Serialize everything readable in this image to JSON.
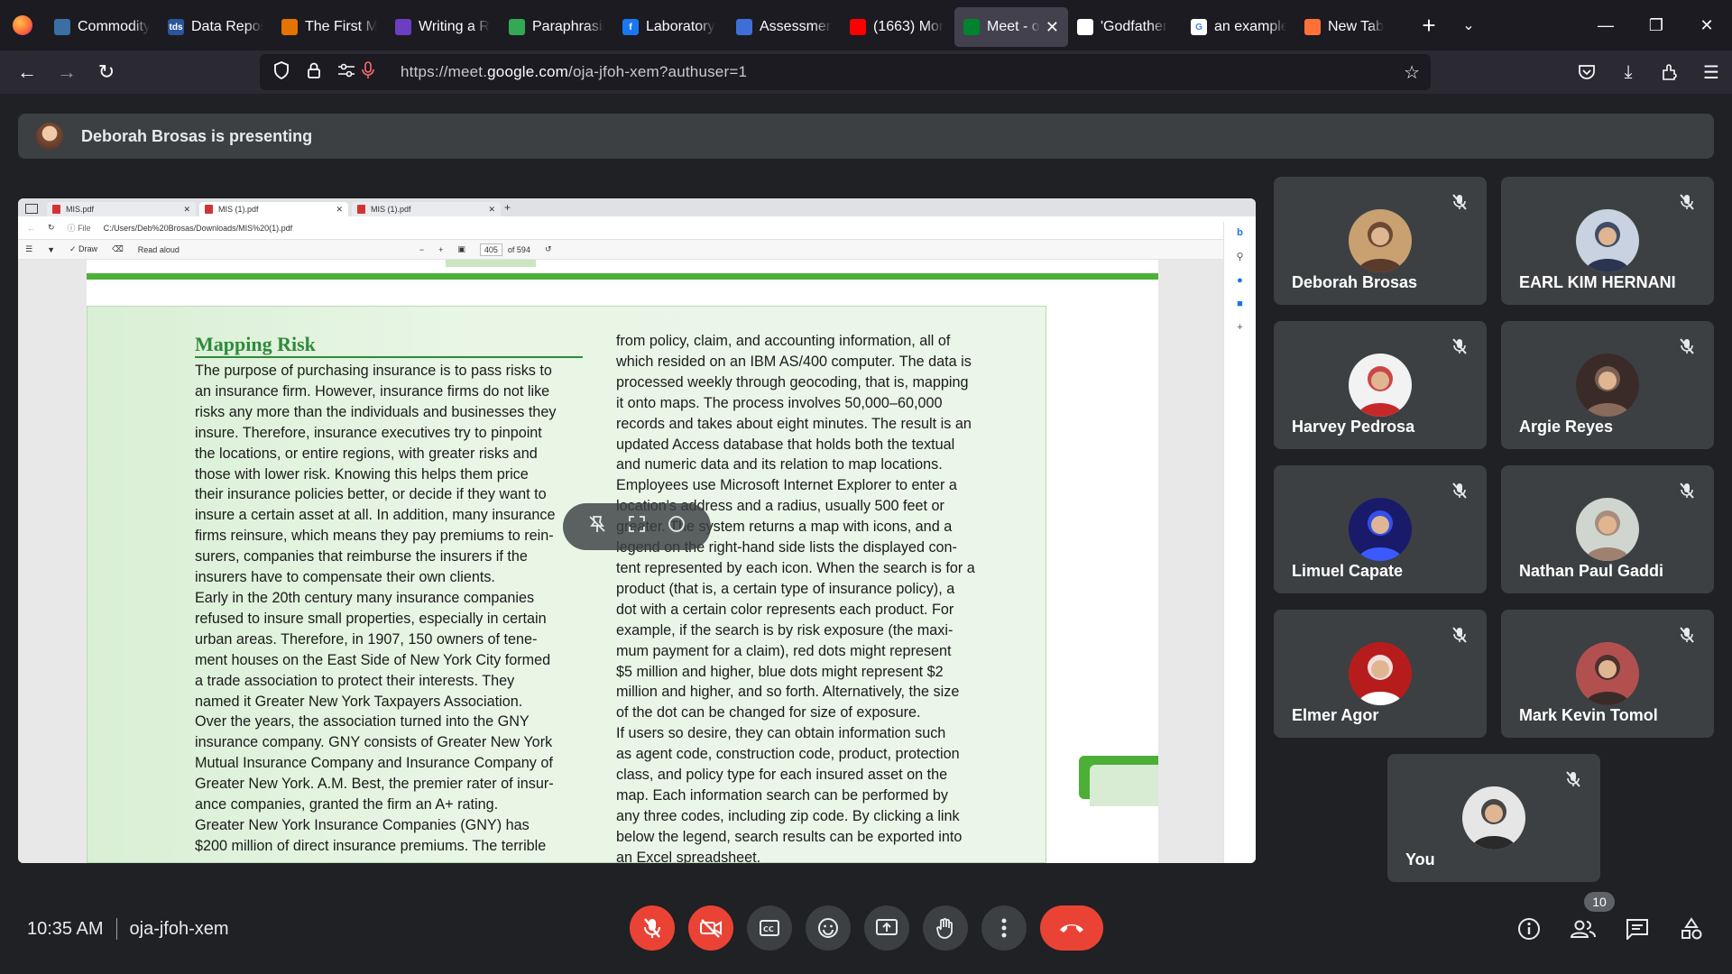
{
  "browser": {
    "tabs": [
      {
        "label": "Commodity",
        "fav_color": "#3b6ea5",
        "fav_text": ""
      },
      {
        "label": "Data Repos",
        "fav_color": "#2a5599",
        "fav_text": "tds"
      },
      {
        "label": "The First M",
        "fav_color": "#e37400",
        "fav_text": ""
      },
      {
        "label": "Writing a R",
        "fav_color": "#6d3fc0",
        "fav_text": ""
      },
      {
        "label": "Paraphrasin",
        "fav_color": "#34a853",
        "fav_text": ""
      },
      {
        "label": "Laboratory",
        "fav_color": "#1877f2",
        "fav_text": "f"
      },
      {
        "label": "Assessment",
        "fav_color": "#3f6fd6",
        "fav_text": ""
      },
      {
        "label": "(1663) Mor",
        "fav_color": "#ff0000",
        "fav_text": ""
      },
      {
        "label": "Meet - o",
        "fav_color": "#00832d",
        "fav_text": "",
        "active": true
      },
      {
        "label": "'Godfather",
        "fav_color": "#ffffff",
        "fav_text": ""
      },
      {
        "label": "an example",
        "fav_color": "#ffffff",
        "fav_text": "G"
      },
      {
        "label": "New Tab",
        "fav_color": "#ff7139",
        "fav_text": ""
      }
    ],
    "url_prefix": "https://meet.",
    "url_host": "google.com",
    "url_path": "/oja-jfoh-xem?authuser=1"
  },
  "banner": {
    "text": "Deborah Brosas is presenting"
  },
  "screen": {
    "edge_tabs": [
      "MIS.pdf",
      "MIS (1).pdf",
      "MIS (1).pdf"
    ],
    "file_label": "File",
    "path": "C:/Users/Deb%20Brosas/Downloads/MIS%20(1).pdf",
    "draw_label": "Draw",
    "read_aloud": "Read aloud",
    "page_num": "405",
    "page_total": "of 594",
    "pdf": {
      "title": "Mapping Risk",
      "col1": [
        "The purpose of purchasing insurance is to pass risks to",
        "an insurance firm. However, insurance firms do not like",
        "risks any more than the individuals and businesses they",
        "insure. Therefore, insurance executives try to pinpoint",
        "the locations, or entire regions, with greater risks and",
        "those with lower risk. Knowing this helps them price",
        "their insurance policies better, or decide if they want to",
        "insure a certain asset at all. In addition, many insurance",
        "firms reinsure, which means they pay premiums to rein-",
        "surers, companies that reimburse the insurers if the",
        "insurers have to compensate their own clients.",
        "    Early in the 20th century many insurance companies",
        "refused to insure small properties, especially in certain",
        "urban areas. Therefore, in 1907, 150 owners of tene-",
        "ment houses on the East Side of New York City formed",
        "a trade association to protect their interests. They",
        "named it Greater New York Taxpayers Association.",
        "Over the years, the association turned into the GNY",
        "insurance company. GNY consists of Greater New York",
        "Mutual Insurance Company and Insurance Company of",
        "Greater New York. A.M. Best, the premier rater of insur-",
        "ance companies, granted the firm an A+ rating.",
        "    Greater New York Insurance Companies (GNY) has",
        "$200 million of direct insurance premiums. The terrible"
      ],
      "col2": [
        "from policy, claim, and accounting information, all of",
        "which resided on an IBM AS/400 computer. The data is",
        "processed weekly through geocoding, that is, mapping",
        "it onto maps. The process involves 50,000–60,000",
        "records and takes about eight minutes. The result is an",
        "updated Access database that holds both the textual",
        "and numeric data and its relation to map locations.",
        "    Employees use Microsoft Internet Explorer to enter a",
        "location's address and a radius, usually 500 feet or",
        "greater. The system returns a map with icons, and a",
        "legend on the right-hand side lists the displayed con-",
        "tent represented by each icon. When the search is for a",
        "product (that is, a certain type of insurance policy), a",
        "dot with a certain color represents each product. For",
        "example, if the search is by risk exposure (the maxi-",
        "mum payment for a claim), red dots might represent",
        "$5 million and higher, blue dots might represent $2",
        "million and higher, and so forth. Alternatively, the size",
        "of the dot can be changed for size of exposure.",
        "    If users so desire, they can obtain information such",
        "as agent code, construction code, product, protection",
        "class, and policy type for each insured asset on the",
        "map. Each information search can be performed by",
        "any three codes, including zip code. By clicking a link",
        "below the legend, search results can be exported into",
        "an Excel spreadsheet."
      ]
    }
  },
  "participants": [
    {
      "name": "Deborah Brosas",
      "avatar_bg": "#c9a070",
      "avatar_fg": "#5a3a2a"
    },
    {
      "name": "EARL KIM HERNANI",
      "avatar_bg": "#c8d2e0",
      "avatar_fg": "#2b3550"
    },
    {
      "name": "Harvey Pedrosa",
      "avatar_bg": "#f2f2f2",
      "avatar_fg": "#c62828"
    },
    {
      "name": "Argie Reyes",
      "avatar_bg": "#3b2b28",
      "avatar_fg": "#8a6a5a"
    },
    {
      "name": "Limuel Capate",
      "avatar_bg": "#1a1a6a",
      "avatar_fg": "#3a5aff"
    },
    {
      "name": "Nathan Paul Gaddi",
      "avatar_bg": "#cfd6cf",
      "avatar_fg": "#a08070"
    },
    {
      "name": "Elmer Agor",
      "avatar_bg": "#b71c1c",
      "avatar_fg": "#ffffff"
    },
    {
      "name": "Mark Kevin Tomol",
      "avatar_bg": "#b25050",
      "avatar_fg": "#3b2b28"
    },
    {
      "name": "You",
      "avatar_bg": "#e6e6e6",
      "avatar_fg": "#2a2a2a"
    }
  ],
  "bottom": {
    "time": "10:35 AM",
    "meeting_code": "oja-jfoh-xem",
    "people_count": "10"
  },
  "colors": {
    "meet_bg": "#202124",
    "tile_bg": "#3c4043",
    "danger": "#ea4335",
    "pdf_green": "#2e8b3a"
  }
}
